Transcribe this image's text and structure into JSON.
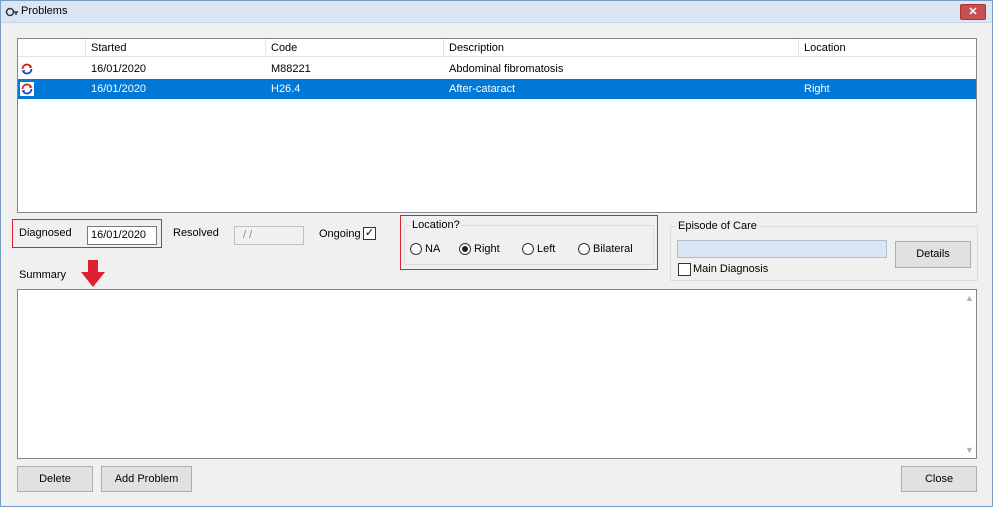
{
  "window": {
    "title": "Problems",
    "close_glyph": "✕"
  },
  "list": {
    "columns": [
      "",
      "Started",
      "Code",
      "Description",
      "Location"
    ],
    "rows": [
      {
        "started": "16/01/2020",
        "code": "M88221",
        "description": "Abdominal fibromatosis",
        "location": "",
        "selected": false
      },
      {
        "started": "16/01/2020",
        "code": "H26.4",
        "description": "After-cataract",
        "location": "Right",
        "selected": true
      }
    ],
    "row_icon": "refresh-cycle-icon"
  },
  "diagnosed": {
    "label": "Diagnosed",
    "value": "16/01/2020"
  },
  "resolved": {
    "label": "Resolved",
    "value": "/ /"
  },
  "ongoing": {
    "label": "Ongoing",
    "checked": true,
    "check_glyph": "✓"
  },
  "location": {
    "title": "Location?",
    "options": [
      "NA",
      "Right",
      "Left",
      "Bilateral"
    ],
    "selected": "Right"
  },
  "episode": {
    "title": "Episode of Care",
    "value": "",
    "main_diagnosis_label": "Main Diagnosis",
    "details_label": "Details"
  },
  "summary": {
    "label": "Summary",
    "value": ""
  },
  "buttons": {
    "delete": "Delete",
    "add_problem": "Add Problem",
    "close": "Close"
  },
  "colors": {
    "selection": "#0078d7",
    "highlight_box": "#e02030",
    "arrow": "#e02030"
  }
}
